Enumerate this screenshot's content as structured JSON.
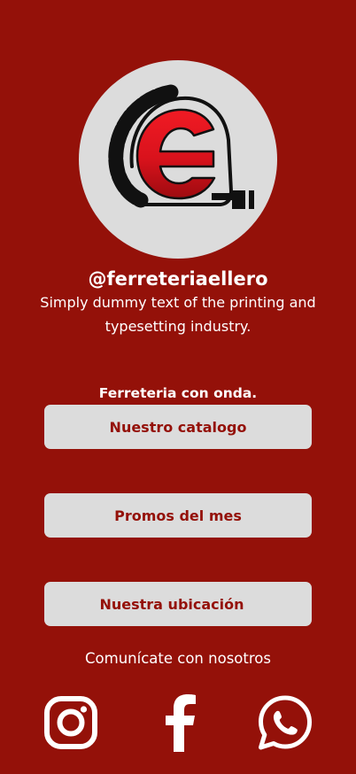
{
  "profile": {
    "handle": "@ferreteriaellero",
    "tagline": "Simply dummy text of the printing and typesetting industry.",
    "logo_icon": "measuring-tape-e-logo"
  },
  "subtitle": "Ferreteria con onda.",
  "buttons": [
    {
      "label": "Nuestro catalogo"
    },
    {
      "label": "Promos del mes"
    },
    {
      "label": "Nuestra ubicación"
    }
  ],
  "contact": {
    "label": "Comunícate con nosotros"
  },
  "social": [
    {
      "icon": "instagram-icon"
    },
    {
      "icon": "facebook-icon"
    },
    {
      "icon": "whatsapp-icon"
    }
  ],
  "colors": {
    "background": "#941109",
    "button_bg": "#dcdcdc",
    "button_text": "#941109",
    "logo_red": "#d9121c"
  }
}
